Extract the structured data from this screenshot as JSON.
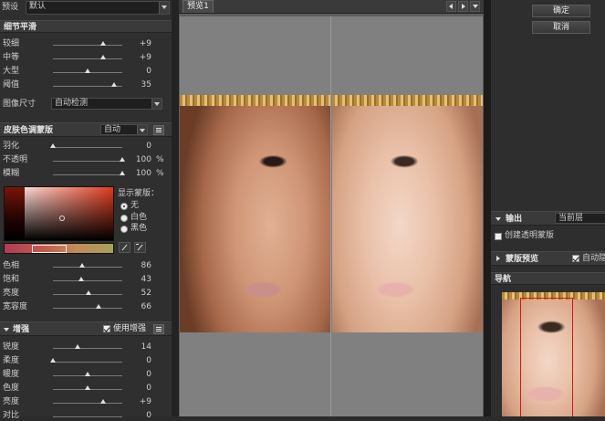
{
  "preset": {
    "label": "预设",
    "value": "默认"
  },
  "detail_smoothing": {
    "title": "细节平滑",
    "sliders": [
      {
        "label": "较细",
        "value": "+9",
        "level": 0.72
      },
      {
        "label": "中等",
        "value": "+9",
        "level": 0.72
      },
      {
        "label": "大型",
        "value": "0",
        "level": 0.5
      },
      {
        "label": "阈值",
        "value": "35",
        "level": 0.88
      }
    ],
    "image_size_label": "图像尺寸",
    "image_size_value": "自动检测"
  },
  "skin_tone": {
    "title": "皮肤色调蒙版",
    "mode": "自动",
    "sliders": [
      {
        "label": "羽化",
        "value": "0",
        "unit": "",
        "level": 0.0
      },
      {
        "label": "不透明",
        "value": "100",
        "unit": "%",
        "level": 1.0
      },
      {
        "label": "模糊",
        "value": "100",
        "unit": "%",
        "level": 1.0
      }
    ],
    "display_mask_label": "显示蒙版：",
    "mask_options": [
      {
        "label": "无",
        "selected": true
      },
      {
        "label": "白色",
        "selected": false
      },
      {
        "label": "黑色",
        "selected": false
      }
    ],
    "color_sliders": [
      {
        "label": "色相",
        "value": "86",
        "level": 0.34
      },
      {
        "label": "饱和",
        "value": "43",
        "level": 0.4
      },
      {
        "label": "亮度",
        "value": "52",
        "level": 0.5
      },
      {
        "label": "宽容度",
        "value": "66",
        "level": 0.66
      }
    ]
  },
  "enhance": {
    "title": "增强",
    "use_enhance_label": "使用增强",
    "use_enhance_checked": true,
    "sliders": [
      {
        "label": "锐度",
        "value": "14",
        "level": 0.35
      },
      {
        "label": "柔度",
        "value": "0",
        "level": 0.0
      },
      {
        "label": "暖度",
        "value": "0",
        "level": 0.5
      },
      {
        "label": "色度",
        "value": "0",
        "level": 0.5
      },
      {
        "label": "亮度",
        "value": "+9",
        "level": 0.72
      },
      {
        "label": "对比",
        "value": "0",
        "level": 0.5
      }
    ]
  },
  "preview": {
    "tab_label": "预览1"
  },
  "right": {
    "ok_label": "确定",
    "cancel_label": "取消",
    "output_title": "输出",
    "output_target": "当前层",
    "create_mask_label": "创建透明蒙版",
    "mask_preview_title": "蒙版预览",
    "auto_label": "自动隐",
    "nav_title": "导航"
  },
  "colors": {
    "panel_bg": "#2f2f2f",
    "header_bg": "#3a3a3a",
    "canvas_bg": "#808080",
    "nav_frame": "#d01818"
  }
}
